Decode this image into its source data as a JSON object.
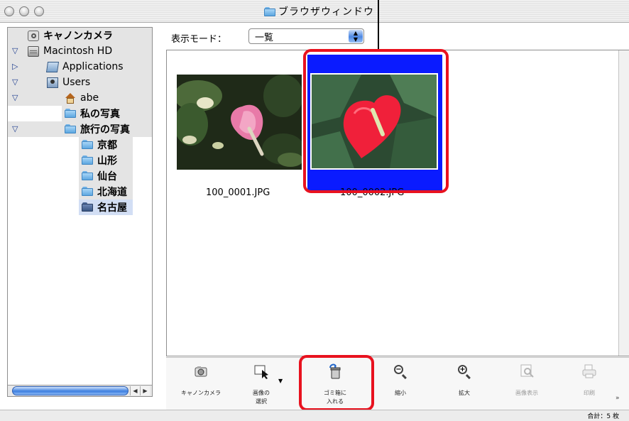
{
  "window": {
    "title": "ブラウザウィンドウ"
  },
  "sidebar": {
    "items": [
      {
        "label": "キャノンカメラ",
        "icon": "camera-icon"
      },
      {
        "label": "Macintosh HD",
        "icon": "hard-disk-icon",
        "disclosure": "expanded"
      },
      {
        "label": "Applications",
        "icon": "applications-folder-icon",
        "disclosure": "collapsed"
      },
      {
        "label": "Users",
        "icon": "users-folder-icon",
        "disclosure": "expanded"
      },
      {
        "label": "abe",
        "icon": "home-icon",
        "disclosure": "expanded"
      },
      {
        "label": "私の写真",
        "icon": "folder-icon"
      },
      {
        "label": "旅行の写真",
        "icon": "folder-icon",
        "disclosure": "expanded"
      },
      {
        "label": "京都",
        "icon": "folder-icon"
      },
      {
        "label": "山形",
        "icon": "folder-icon"
      },
      {
        "label": "仙台",
        "icon": "folder-icon"
      },
      {
        "label": "北海道",
        "icon": "folder-icon"
      },
      {
        "label": "名古屋",
        "icon": "folder-icon",
        "selected": true
      }
    ]
  },
  "view": {
    "mode_label": "表示モード：",
    "mode_value": "一覧"
  },
  "images": [
    {
      "filename": "100_0001.JPG",
      "selected": false
    },
    {
      "filename": "100_0002.JPG",
      "selected": true
    }
  ],
  "toolbar": {
    "buttons": [
      {
        "label": "キャノンカメラ",
        "icon": "camera-icon",
        "enabled": true
      },
      {
        "label": "画像の\n選択",
        "icon": "select-image-icon",
        "enabled": true
      },
      {
        "label": "ゴミ箱に\n入れる",
        "icon": "trash-icon",
        "enabled": true
      },
      {
        "label": "縮小",
        "icon": "zoom-out-icon",
        "enabled": true
      },
      {
        "label": "拡大",
        "icon": "zoom-in-icon",
        "enabled": true
      },
      {
        "label": "画像表示",
        "icon": "view-image-icon",
        "enabled": false
      },
      {
        "label": "印刷",
        "icon": "print-icon",
        "enabled": false
      }
    ],
    "overflow": "»"
  },
  "status": {
    "total": "合計：5 枚"
  },
  "colors": {
    "selection_blue": "#0a1bff",
    "highlight_red": "#e8121f"
  }
}
